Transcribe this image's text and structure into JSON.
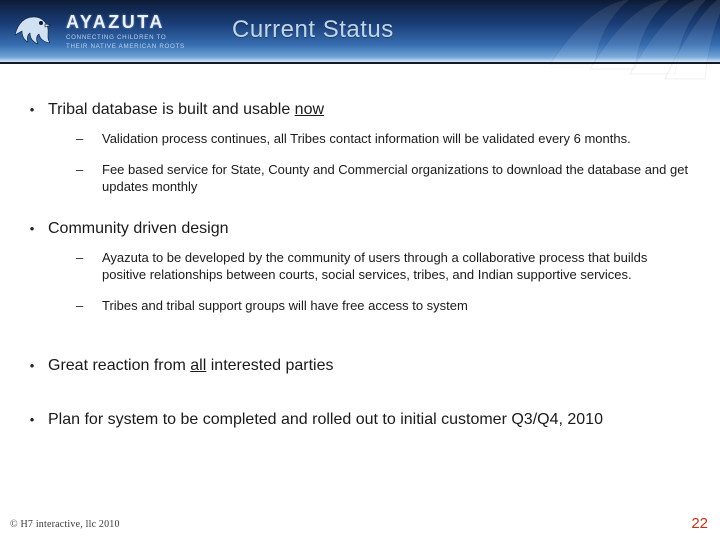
{
  "brand": {
    "name": "AYAZUTA",
    "tagline_l1": "CONNECTING CHILDREN TO",
    "tagline_l2": "THEIR NATIVE AMERICAN ROOTS"
  },
  "title": "Current Status",
  "bullets": [
    {
      "text_pre": "Tribal database is built and usable ",
      "text_u": "now",
      "text_post": "",
      "sub": [
        "Validation process continues, all Tribes contact information will be validated every 6 months.",
        "Fee based service for State, County and Commercial organizations to download the database and get updates monthly"
      ]
    },
    {
      "text_pre": "Community driven design",
      "text_u": "",
      "text_post": "",
      "sub": [
        "Ayazuta to be developed by the community of users through a collaborative process that builds positive relationships between courts, social services, tribes, and Indian supportive services.",
        "Tribes and tribal support groups will have free access to system"
      ]
    },
    {
      "text_pre": "Great reaction from ",
      "text_u": "all",
      "text_post": " interested parties",
      "sub": []
    },
    {
      "text_pre": "Plan for system to be completed and rolled out to initial customer Q3/Q4, 2010",
      "text_u": "",
      "text_post": "",
      "sub": []
    }
  ],
  "footer": {
    "copyright": "© H7 interactive, llc 2010",
    "page": "22"
  }
}
